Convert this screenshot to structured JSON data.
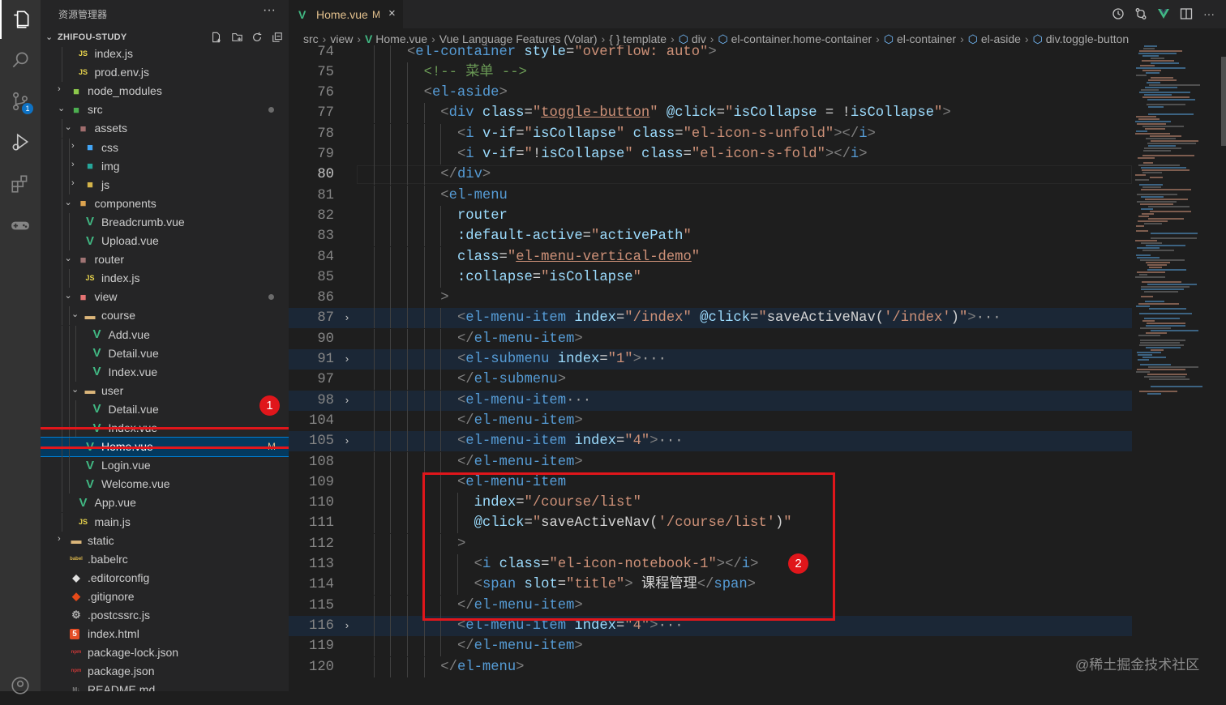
{
  "activity_bar": {
    "items": [
      {
        "name": "explorer-icon"
      },
      {
        "name": "search-icon"
      },
      {
        "name": "source-control-icon",
        "badge": "1"
      },
      {
        "name": "run-debug-icon"
      },
      {
        "name": "extensions-icon"
      },
      {
        "name": "gamepad-icon"
      },
      {
        "name": "account-icon"
      }
    ]
  },
  "sidebar": {
    "title": "资源管理器",
    "more": "···",
    "project": "ZHIFOU-STUDY",
    "tree": [
      {
        "label": "index.js",
        "icon": "js",
        "depth": 1,
        "twisty": ""
      },
      {
        "label": "prod.env.js",
        "icon": "js",
        "depth": 1,
        "twisty": ""
      },
      {
        "label": "node_modules",
        "icon": "folder-node",
        "depth": 0,
        "twisty": "›"
      },
      {
        "label": "src",
        "icon": "folder-src",
        "depth": 0,
        "twisty": "⌄",
        "dot": true
      },
      {
        "label": "assets",
        "icon": "folder-assets",
        "depth": 1,
        "twisty": "⌄"
      },
      {
        "label": "css",
        "icon": "folder-css",
        "depth": 2,
        "twisty": "›"
      },
      {
        "label": "img",
        "icon": "folder-img",
        "depth": 2,
        "twisty": "›"
      },
      {
        "label": "js",
        "icon": "folder-js",
        "depth": 2,
        "twisty": "›"
      },
      {
        "label": "components",
        "icon": "folder-components",
        "depth": 1,
        "twisty": "⌄"
      },
      {
        "label": "Breadcrumb.vue",
        "icon": "vue",
        "depth": 2,
        "twisty": ""
      },
      {
        "label": "Upload.vue",
        "icon": "vue",
        "depth": 2,
        "twisty": ""
      },
      {
        "label": "router",
        "icon": "folder-router",
        "depth": 1,
        "twisty": "⌄"
      },
      {
        "label": "index.js",
        "icon": "js",
        "depth": 2,
        "twisty": ""
      },
      {
        "label": "view",
        "icon": "folder-view",
        "depth": 1,
        "twisty": "⌄",
        "dot": true
      },
      {
        "label": "course",
        "icon": "folder",
        "depth": 2,
        "twisty": "⌄"
      },
      {
        "label": "Add.vue",
        "icon": "vue",
        "depth": 3,
        "twisty": ""
      },
      {
        "label": "Detail.vue",
        "icon": "vue",
        "depth": 3,
        "twisty": ""
      },
      {
        "label": "Index.vue",
        "icon": "vue",
        "depth": 3,
        "twisty": ""
      },
      {
        "label": "user",
        "icon": "folder",
        "depth": 2,
        "twisty": "⌄"
      },
      {
        "label": "Detail.vue",
        "icon": "vue",
        "depth": 3,
        "twisty": ""
      },
      {
        "label": "Index.vue",
        "icon": "vue",
        "depth": 3,
        "twisty": ""
      },
      {
        "label": "Home.vue",
        "icon": "vue",
        "depth": 2,
        "twisty": "",
        "selected": true,
        "status": "M"
      },
      {
        "label": "Login.vue",
        "icon": "vue",
        "depth": 2,
        "twisty": ""
      },
      {
        "label": "Welcome.vue",
        "icon": "vue",
        "depth": 2,
        "twisty": ""
      },
      {
        "label": "App.vue",
        "icon": "vue",
        "depth": 1,
        "twisty": ""
      },
      {
        "label": "main.js",
        "icon": "js",
        "depth": 1,
        "twisty": ""
      },
      {
        "label": "static",
        "icon": "folder",
        "depth": 0,
        "twisty": "›"
      },
      {
        "label": ".babelrc",
        "icon": "babel",
        "depth": 0,
        "twisty": ""
      },
      {
        "label": ".editorconfig",
        "icon": "editorconfig",
        "depth": 0,
        "twisty": ""
      },
      {
        "label": ".gitignore",
        "icon": "git",
        "depth": 0,
        "twisty": ""
      },
      {
        "label": ".postcssrc.js",
        "icon": "postcss",
        "depth": 0,
        "twisty": ""
      },
      {
        "label": "index.html",
        "icon": "html",
        "depth": 0,
        "twisty": ""
      },
      {
        "label": "package-lock.json",
        "icon": "npm",
        "depth": 0,
        "twisty": ""
      },
      {
        "label": "package.json",
        "icon": "npm",
        "depth": 0,
        "twisty": ""
      },
      {
        "label": "README.md",
        "icon": "md",
        "depth": 0,
        "twisty": ""
      }
    ]
  },
  "editor": {
    "tab": {
      "label": "Home.vue",
      "status": "M",
      "close": "×"
    },
    "breadcrumbs": [
      "src",
      "view",
      "Home.vue",
      "Vue Language Features (Volar)",
      "{ } template",
      "div",
      "el-container.home-container",
      "el-container",
      "el-aside",
      "div.toggle-button"
    ],
    "lines": [
      {
        "n": "74",
        "indent": 3,
        "fold": "",
        "tokens": [
          [
            "br",
            "<"
          ],
          [
            "tg",
            "el-container"
          ],
          [
            "tx",
            " "
          ],
          [
            "at",
            "style"
          ],
          [
            "eq",
            "="
          ],
          [
            "st",
            "\"overflow: auto\""
          ],
          [
            "br",
            ">"
          ]
        ]
      },
      {
        "n": "75",
        "indent": 4,
        "fold": "",
        "tokens": [
          [
            "cm",
            "<!-- 菜单 -->"
          ]
        ]
      },
      {
        "n": "76",
        "indent": 4,
        "fold": "",
        "tokens": [
          [
            "br",
            "<"
          ],
          [
            "tg",
            "el-aside"
          ],
          [
            "br",
            ">"
          ]
        ]
      },
      {
        "n": "77",
        "indent": 5,
        "fold": "",
        "tokens": [
          [
            "br",
            "<"
          ],
          [
            "tg",
            "div"
          ],
          [
            "tx",
            " "
          ],
          [
            "at",
            "class"
          ],
          [
            "eq",
            "="
          ],
          [
            "st",
            "\""
          ],
          [
            "stu",
            "toggle-button"
          ],
          [
            "st",
            "\""
          ],
          [
            "tx",
            " "
          ],
          [
            "at",
            "@click"
          ],
          [
            "eq",
            "="
          ],
          [
            "st",
            "\""
          ],
          [
            "at",
            "isCollapse"
          ],
          [
            "tx",
            " = !"
          ],
          [
            "at",
            "isCollapse"
          ],
          [
            "st",
            "\""
          ],
          [
            "br",
            ">"
          ]
        ]
      },
      {
        "n": "78",
        "indent": 6,
        "fold": "",
        "tokens": [
          [
            "br",
            "<"
          ],
          [
            "tg",
            "i"
          ],
          [
            "tx",
            " "
          ],
          [
            "at",
            "v-if"
          ],
          [
            "eq",
            "="
          ],
          [
            "st",
            "\""
          ],
          [
            "at",
            "isCollapse"
          ],
          [
            "st",
            "\""
          ],
          [
            "tx",
            " "
          ],
          [
            "at",
            "class"
          ],
          [
            "eq",
            "="
          ],
          [
            "st",
            "\"el-icon-s-unfold\""
          ],
          [
            "br",
            "></"
          ],
          [
            "tg",
            "i"
          ],
          [
            "br",
            ">"
          ]
        ]
      },
      {
        "n": "79",
        "indent": 6,
        "fold": "",
        "tokens": [
          [
            "br",
            "<"
          ],
          [
            "tg",
            "i"
          ],
          [
            "tx",
            " "
          ],
          [
            "at",
            "v-if"
          ],
          [
            "eq",
            "="
          ],
          [
            "st",
            "\""
          ],
          [
            "tx",
            "!"
          ],
          [
            "at",
            "isCollapse"
          ],
          [
            "st",
            "\""
          ],
          [
            "tx",
            " "
          ],
          [
            "at",
            "class"
          ],
          [
            "eq",
            "="
          ],
          [
            "st",
            "\"el-icon-s-fold\""
          ],
          [
            "br",
            "></"
          ],
          [
            "tg",
            "i"
          ],
          [
            "br",
            ">"
          ]
        ]
      },
      {
        "n": "80",
        "indent": 5,
        "fold": "",
        "cur": true,
        "tokens": [
          [
            "br",
            "</"
          ],
          [
            "tg",
            "div"
          ],
          [
            "br",
            ">"
          ]
        ]
      },
      {
        "n": "81",
        "indent": 5,
        "fold": "",
        "tokens": [
          [
            "br",
            "<"
          ],
          [
            "tg",
            "el-menu"
          ]
        ]
      },
      {
        "n": "82",
        "indent": 6,
        "fold": "",
        "tokens": [
          [
            "at",
            "router"
          ]
        ]
      },
      {
        "n": "83",
        "indent": 6,
        "fold": "",
        "tokens": [
          [
            "at",
            ":default-active"
          ],
          [
            "eq",
            "="
          ],
          [
            "st",
            "\""
          ],
          [
            "at",
            "activePath"
          ],
          [
            "st",
            "\""
          ]
        ]
      },
      {
        "n": "84",
        "indent": 6,
        "fold": "",
        "tokens": [
          [
            "at",
            "class"
          ],
          [
            "eq",
            "="
          ],
          [
            "st",
            "\""
          ],
          [
            "stu",
            "el-menu-vertical-demo"
          ],
          [
            "st",
            "\""
          ]
        ]
      },
      {
        "n": "85",
        "indent": 6,
        "fold": "",
        "tokens": [
          [
            "at",
            ":collapse"
          ],
          [
            "eq",
            "="
          ],
          [
            "st",
            "\""
          ],
          [
            "at",
            "isCollapse"
          ],
          [
            "st",
            "\""
          ]
        ]
      },
      {
        "n": "86",
        "indent": 5,
        "fold": "",
        "tokens": [
          [
            "br",
            ">"
          ]
        ]
      },
      {
        "n": "87",
        "indent": 6,
        "fold": "›",
        "hl": true,
        "tokens": [
          [
            "br",
            "<"
          ],
          [
            "tg",
            "el-menu-item"
          ],
          [
            "tx",
            " "
          ],
          [
            "at",
            "index"
          ],
          [
            "eq",
            "="
          ],
          [
            "st",
            "\"/index\""
          ],
          [
            "tx",
            " "
          ],
          [
            "at",
            "@click"
          ],
          [
            "eq",
            "="
          ],
          [
            "st",
            "\""
          ],
          [
            "tx",
            "saveActiveNav("
          ],
          [
            "st",
            "'/index'"
          ],
          [
            "tx",
            ")"
          ],
          [
            "st",
            "\""
          ],
          [
            "br",
            ">"
          ],
          [
            "el",
            "···"
          ]
        ]
      },
      {
        "n": "90",
        "indent": 6,
        "fold": "",
        "tokens": [
          [
            "br",
            "</"
          ],
          [
            "tg",
            "el-menu-item"
          ],
          [
            "br",
            ">"
          ]
        ]
      },
      {
        "n": "91",
        "indent": 6,
        "fold": "›",
        "hl": true,
        "tokens": [
          [
            "br",
            "<"
          ],
          [
            "tg",
            "el-submenu"
          ],
          [
            "tx",
            " "
          ],
          [
            "at",
            "index"
          ],
          [
            "eq",
            "="
          ],
          [
            "st",
            "\"1\""
          ],
          [
            "br",
            ">"
          ],
          [
            "el",
            "···"
          ]
        ]
      },
      {
        "n": "97",
        "indent": 6,
        "fold": "",
        "tokens": [
          [
            "br",
            "</"
          ],
          [
            "tg",
            "el-submenu"
          ],
          [
            "br",
            ">"
          ]
        ]
      },
      {
        "n": "98",
        "indent": 6,
        "fold": "›",
        "hl": true,
        "tokens": [
          [
            "br",
            "<"
          ],
          [
            "tg",
            "el-menu-item"
          ],
          [
            "el",
            "···"
          ]
        ]
      },
      {
        "n": "104",
        "indent": 6,
        "fold": "",
        "tokens": [
          [
            "br",
            "</"
          ],
          [
            "tg",
            "el-menu-item"
          ],
          [
            "br",
            ">"
          ]
        ]
      },
      {
        "n": "105",
        "indent": 6,
        "fold": "›",
        "hl": true,
        "tokens": [
          [
            "br",
            "<"
          ],
          [
            "tg",
            "el-menu-item"
          ],
          [
            "tx",
            " "
          ],
          [
            "at",
            "index"
          ],
          [
            "eq",
            "="
          ],
          [
            "st",
            "\"4\""
          ],
          [
            "br",
            ">"
          ],
          [
            "el",
            "···"
          ]
        ]
      },
      {
        "n": "108",
        "indent": 6,
        "fold": "",
        "tokens": [
          [
            "br",
            "</"
          ],
          [
            "tg",
            "el-menu-item"
          ],
          [
            "br",
            ">"
          ]
        ]
      },
      {
        "n": "109",
        "indent": 6,
        "fold": "",
        "tokens": [
          [
            "br",
            "<"
          ],
          [
            "tg",
            "el-menu-item"
          ]
        ]
      },
      {
        "n": "110",
        "indent": 7,
        "fold": "",
        "tokens": [
          [
            "at",
            "index"
          ],
          [
            "eq",
            "="
          ],
          [
            "st",
            "\"/course/list\""
          ]
        ]
      },
      {
        "n": "111",
        "indent": 7,
        "fold": "",
        "tokens": [
          [
            "at",
            "@click"
          ],
          [
            "eq",
            "="
          ],
          [
            "st",
            "\""
          ],
          [
            "tx",
            "saveActiveNav("
          ],
          [
            "st",
            "'/course/list'"
          ],
          [
            "tx",
            ")"
          ],
          [
            "st",
            "\""
          ]
        ]
      },
      {
        "n": "112",
        "indent": 6,
        "fold": "",
        "tokens": [
          [
            "br",
            ">"
          ]
        ]
      },
      {
        "n": "113",
        "indent": 7,
        "fold": "",
        "tokens": [
          [
            "br",
            "<"
          ],
          [
            "tg",
            "i"
          ],
          [
            "tx",
            " "
          ],
          [
            "at",
            "class"
          ],
          [
            "eq",
            "="
          ],
          [
            "st",
            "\"el-icon-notebook-1\""
          ],
          [
            "br",
            "></"
          ],
          [
            "tg",
            "i"
          ],
          [
            "br",
            ">"
          ]
        ]
      },
      {
        "n": "114",
        "indent": 7,
        "fold": "",
        "tokens": [
          [
            "br",
            "<"
          ],
          [
            "tg",
            "span"
          ],
          [
            "tx",
            " "
          ],
          [
            "at",
            "slot"
          ],
          [
            "eq",
            "="
          ],
          [
            "st",
            "\"title\""
          ],
          [
            "br",
            ">"
          ],
          [
            "tx",
            " 课程管理"
          ],
          [
            "br",
            "</"
          ],
          [
            "tg",
            "span"
          ],
          [
            "br",
            ">"
          ]
        ]
      },
      {
        "n": "115",
        "indent": 6,
        "fold": "",
        "tokens": [
          [
            "br",
            "</"
          ],
          [
            "tg",
            "el-menu-item"
          ],
          [
            "br",
            ">"
          ]
        ]
      },
      {
        "n": "116",
        "indent": 6,
        "fold": "›",
        "hl": true,
        "tokens": [
          [
            "br",
            "<"
          ],
          [
            "tg",
            "el-menu-item"
          ],
          [
            "tx",
            " "
          ],
          [
            "at",
            "index"
          ],
          [
            "eq",
            "="
          ],
          [
            "st",
            "\"4\""
          ],
          [
            "br",
            ">"
          ],
          [
            "el",
            "···"
          ]
        ]
      },
      {
        "n": "119",
        "indent": 6,
        "fold": "",
        "tokens": [
          [
            "br",
            "</"
          ],
          [
            "tg",
            "el-menu-item"
          ],
          [
            "br",
            ">"
          ]
        ]
      },
      {
        "n": "120",
        "indent": 5,
        "fold": "",
        "tokens": [
          [
            "br",
            "</"
          ],
          [
            "tg",
            "el-menu"
          ],
          [
            "br",
            ">"
          ]
        ]
      }
    ]
  },
  "annotations": {
    "marker1": "1",
    "marker2": "2"
  },
  "watermark": "@稀土掘金技术社区",
  "colors": {
    "tag": "#569cd6",
    "attr": "#9cdcfe",
    "string": "#ce9178",
    "comment": "#6a9955",
    "highlight_red": "#e0161b",
    "vue_green": "#41b883",
    "modified": "#e2c08d"
  }
}
